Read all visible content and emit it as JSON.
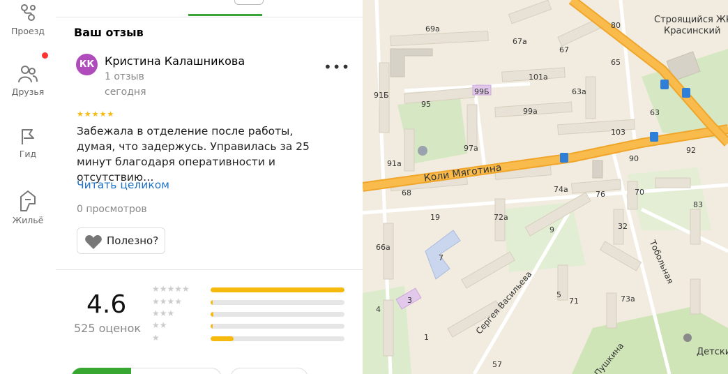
{
  "rail": {
    "items": [
      {
        "label": "Проезд",
        "icon": "route-icon"
      },
      {
        "label": "Друзья",
        "icon": "friends-icon"
      },
      {
        "label": "Гид",
        "icon": "flag-icon"
      },
      {
        "label": "Жильё",
        "icon": "house-icon"
      }
    ]
  },
  "review": {
    "section_title": "Ваш отзыв",
    "avatar_initials": "КК",
    "author": "Кристина Калашникова",
    "author_reviews": "1 отзыв",
    "date": "сегодня",
    "more": "•••",
    "stars": "★★★★★",
    "stars_value": 5,
    "text": "Забежала в отделение после работы, думая, что задержусь. Управилась за 25 минут благодаря оперативности и отсутствию…",
    "read_more": "Читать целиком",
    "views": "0 просмотров",
    "useful": "Полезно?"
  },
  "rating": {
    "value": "4.6",
    "count": "525 оценок",
    "distribution": [
      {
        "stars": "★★★★★",
        "fraction": 1.0
      },
      {
        "stars": "★★★★",
        "fraction": 0.01
      },
      {
        "stars": "★★★",
        "fraction": 0.02
      },
      {
        "stars": "★★",
        "fraction": 0.01
      },
      {
        "stars": "★",
        "fraction": 0.17
      }
    ]
  },
  "colors": {
    "accent_green": "#37a732",
    "star_yellow": "#f6b90e",
    "link_blue": "#1f72c6",
    "avatar_purple": "#b04bbb",
    "road_orange": "#f6a625"
  },
  "map": {
    "streets": [
      "Коли Мяготина",
      "Сергея Васильева",
      "Тобольная",
      "Пушкина"
    ],
    "places": [
      "Строящийся ЖК Красинский",
      "Детский парк"
    ],
    "house_numbers": [
      "69а",
      "67а",
      "67",
      "80",
      "65",
      "101а",
      "63а",
      "99Б",
      "91Б",
      "95",
      "99а",
      "63",
      "103",
      "91а",
      "97а",
      "92",
      "90",
      "68",
      "74а",
      "76",
      "70",
      "83",
      "19",
      "72а",
      "9",
      "32",
      "66а",
      "7",
      "5",
      "71",
      "73а",
      "3",
      "4",
      "1",
      "57"
    ]
  }
}
